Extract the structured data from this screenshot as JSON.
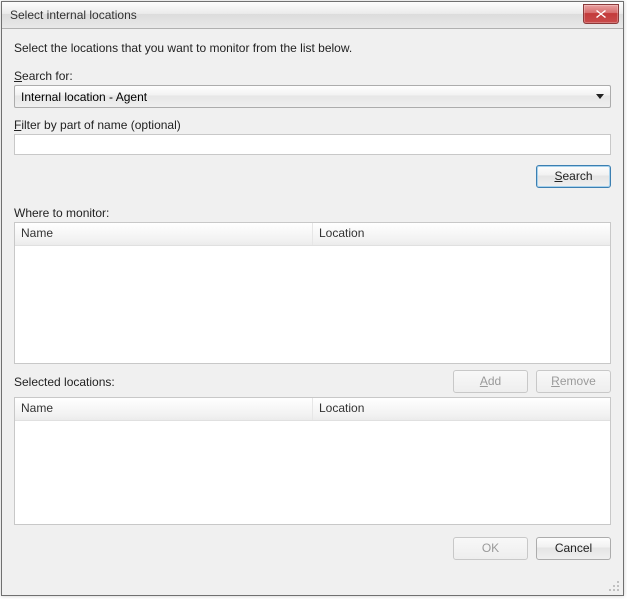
{
  "window": {
    "title": "Select internal locations"
  },
  "instruction": "Select the locations that you want to monitor from the list below.",
  "searchFor": {
    "label": "Search for:",
    "value": "Internal location - Agent"
  },
  "filter": {
    "label": "Filter by part of name (optional)",
    "value": ""
  },
  "buttons": {
    "search": "Search",
    "add": "Add",
    "remove": "Remove",
    "ok": "OK",
    "cancel": "Cancel"
  },
  "monitorSection": {
    "label": "Where to monitor:",
    "columns": {
      "name": "Name",
      "location": "Location"
    }
  },
  "selectedSection": {
    "label": "Selected locations:",
    "columns": {
      "name": "Name",
      "location": "Location"
    }
  }
}
